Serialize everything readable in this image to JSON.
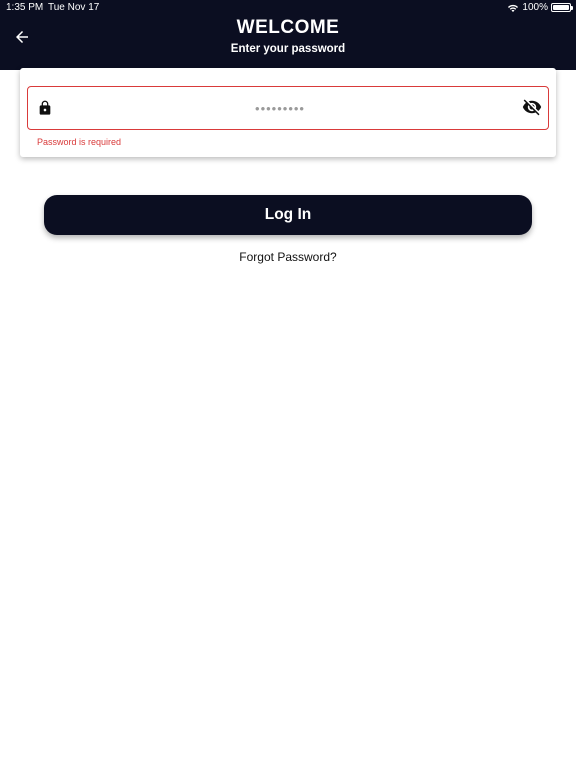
{
  "status_bar": {
    "time": "1:35 PM",
    "date": "Tue Nov 17",
    "battery": "100%",
    "icons": [
      "wifi-icon",
      "battery-icon"
    ]
  },
  "header": {
    "title": "WELCOME",
    "subtitle": "Enter your password",
    "back_icon": "arrow-left-icon",
    "background": "#0b0e21"
  },
  "password_field": {
    "placeholder": "•••••••••",
    "value": "",
    "lock_icon": "lock-icon",
    "visibility_icon": "eye-off-icon",
    "error": "Password is required",
    "error_color": "#d93a3a"
  },
  "login_button": {
    "label": "Log In"
  },
  "forgot_password": {
    "label": "Forgot Password?"
  }
}
